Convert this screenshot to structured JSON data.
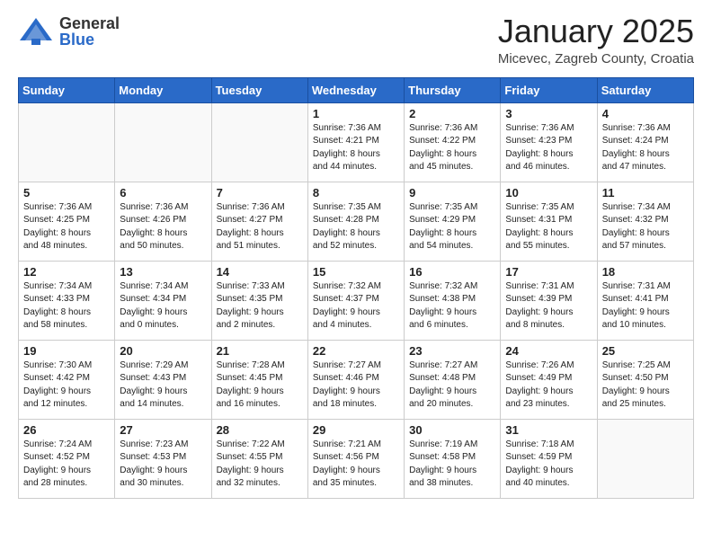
{
  "logo": {
    "general": "General",
    "blue": "Blue"
  },
  "header": {
    "title": "January 2025",
    "location": "Micevec, Zagreb County, Croatia"
  },
  "weekdays": [
    "Sunday",
    "Monday",
    "Tuesday",
    "Wednesday",
    "Thursday",
    "Friday",
    "Saturday"
  ],
  "weeks": [
    [
      {
        "day": "",
        "info": ""
      },
      {
        "day": "",
        "info": ""
      },
      {
        "day": "",
        "info": ""
      },
      {
        "day": "1",
        "info": "Sunrise: 7:36 AM\nSunset: 4:21 PM\nDaylight: 8 hours\nand 44 minutes."
      },
      {
        "day": "2",
        "info": "Sunrise: 7:36 AM\nSunset: 4:22 PM\nDaylight: 8 hours\nand 45 minutes."
      },
      {
        "day": "3",
        "info": "Sunrise: 7:36 AM\nSunset: 4:23 PM\nDaylight: 8 hours\nand 46 minutes."
      },
      {
        "day": "4",
        "info": "Sunrise: 7:36 AM\nSunset: 4:24 PM\nDaylight: 8 hours\nand 47 minutes."
      }
    ],
    [
      {
        "day": "5",
        "info": "Sunrise: 7:36 AM\nSunset: 4:25 PM\nDaylight: 8 hours\nand 48 minutes."
      },
      {
        "day": "6",
        "info": "Sunrise: 7:36 AM\nSunset: 4:26 PM\nDaylight: 8 hours\nand 50 minutes."
      },
      {
        "day": "7",
        "info": "Sunrise: 7:36 AM\nSunset: 4:27 PM\nDaylight: 8 hours\nand 51 minutes."
      },
      {
        "day": "8",
        "info": "Sunrise: 7:35 AM\nSunset: 4:28 PM\nDaylight: 8 hours\nand 52 minutes."
      },
      {
        "day": "9",
        "info": "Sunrise: 7:35 AM\nSunset: 4:29 PM\nDaylight: 8 hours\nand 54 minutes."
      },
      {
        "day": "10",
        "info": "Sunrise: 7:35 AM\nSunset: 4:31 PM\nDaylight: 8 hours\nand 55 minutes."
      },
      {
        "day": "11",
        "info": "Sunrise: 7:34 AM\nSunset: 4:32 PM\nDaylight: 8 hours\nand 57 minutes."
      }
    ],
    [
      {
        "day": "12",
        "info": "Sunrise: 7:34 AM\nSunset: 4:33 PM\nDaylight: 8 hours\nand 58 minutes."
      },
      {
        "day": "13",
        "info": "Sunrise: 7:34 AM\nSunset: 4:34 PM\nDaylight: 9 hours\nand 0 minutes."
      },
      {
        "day": "14",
        "info": "Sunrise: 7:33 AM\nSunset: 4:35 PM\nDaylight: 9 hours\nand 2 minutes."
      },
      {
        "day": "15",
        "info": "Sunrise: 7:32 AM\nSunset: 4:37 PM\nDaylight: 9 hours\nand 4 minutes."
      },
      {
        "day": "16",
        "info": "Sunrise: 7:32 AM\nSunset: 4:38 PM\nDaylight: 9 hours\nand 6 minutes."
      },
      {
        "day": "17",
        "info": "Sunrise: 7:31 AM\nSunset: 4:39 PM\nDaylight: 9 hours\nand 8 minutes."
      },
      {
        "day": "18",
        "info": "Sunrise: 7:31 AM\nSunset: 4:41 PM\nDaylight: 9 hours\nand 10 minutes."
      }
    ],
    [
      {
        "day": "19",
        "info": "Sunrise: 7:30 AM\nSunset: 4:42 PM\nDaylight: 9 hours\nand 12 minutes."
      },
      {
        "day": "20",
        "info": "Sunrise: 7:29 AM\nSunset: 4:43 PM\nDaylight: 9 hours\nand 14 minutes."
      },
      {
        "day": "21",
        "info": "Sunrise: 7:28 AM\nSunset: 4:45 PM\nDaylight: 9 hours\nand 16 minutes."
      },
      {
        "day": "22",
        "info": "Sunrise: 7:27 AM\nSunset: 4:46 PM\nDaylight: 9 hours\nand 18 minutes."
      },
      {
        "day": "23",
        "info": "Sunrise: 7:27 AM\nSunset: 4:48 PM\nDaylight: 9 hours\nand 20 minutes."
      },
      {
        "day": "24",
        "info": "Sunrise: 7:26 AM\nSunset: 4:49 PM\nDaylight: 9 hours\nand 23 minutes."
      },
      {
        "day": "25",
        "info": "Sunrise: 7:25 AM\nSunset: 4:50 PM\nDaylight: 9 hours\nand 25 minutes."
      }
    ],
    [
      {
        "day": "26",
        "info": "Sunrise: 7:24 AM\nSunset: 4:52 PM\nDaylight: 9 hours\nand 28 minutes."
      },
      {
        "day": "27",
        "info": "Sunrise: 7:23 AM\nSunset: 4:53 PM\nDaylight: 9 hours\nand 30 minutes."
      },
      {
        "day": "28",
        "info": "Sunrise: 7:22 AM\nSunset: 4:55 PM\nDaylight: 9 hours\nand 32 minutes."
      },
      {
        "day": "29",
        "info": "Sunrise: 7:21 AM\nSunset: 4:56 PM\nDaylight: 9 hours\nand 35 minutes."
      },
      {
        "day": "30",
        "info": "Sunrise: 7:19 AM\nSunset: 4:58 PM\nDaylight: 9 hours\nand 38 minutes."
      },
      {
        "day": "31",
        "info": "Sunrise: 7:18 AM\nSunset: 4:59 PM\nDaylight: 9 hours\nand 40 minutes."
      },
      {
        "day": "",
        "info": ""
      }
    ]
  ]
}
